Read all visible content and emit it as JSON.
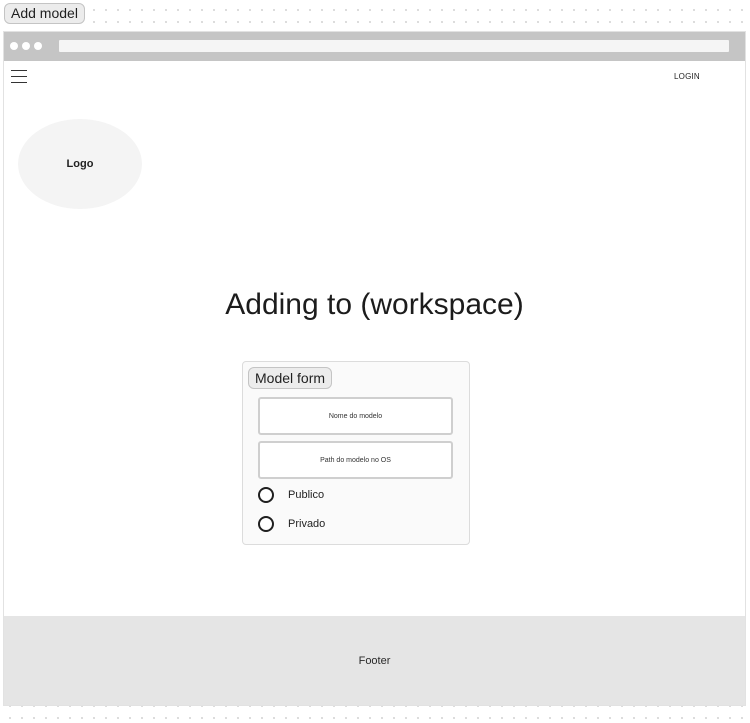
{
  "frame": {
    "label": "Add model"
  },
  "navbar": {
    "login_label": "LOGIN",
    "menu_icon": "hamburger-menu-icon"
  },
  "logo": {
    "label": "Logo"
  },
  "main": {
    "title": "Adding to (workspace)",
    "form": {
      "label": "Model form",
      "fields": [
        {
          "placeholder": "Nome do modelo"
        },
        {
          "placeholder": "Path do modelo no OS"
        }
      ],
      "radio_options": [
        {
          "label": "Publico"
        },
        {
          "label": "Privado"
        }
      ]
    }
  },
  "footer": {
    "label": "Footer"
  },
  "colors": {
    "browser_bar": "#c5c5c5",
    "footer_bg": "#e5e5e5",
    "logo_bg": "#f4f4f4",
    "label_bg": "#ececec"
  }
}
